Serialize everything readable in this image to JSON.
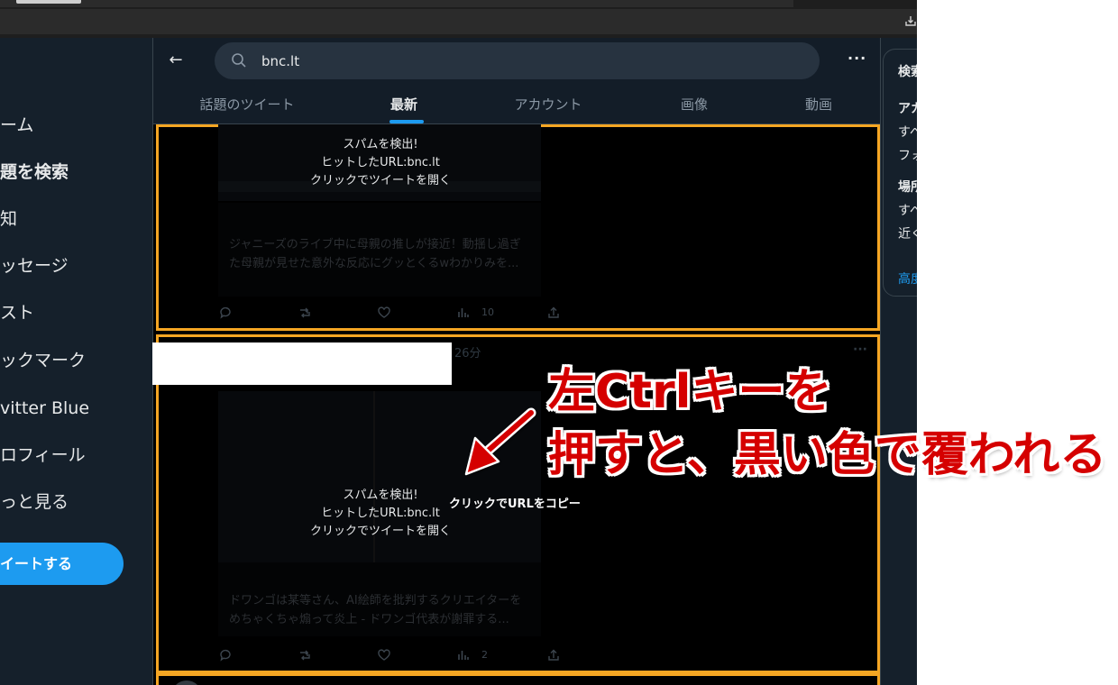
{
  "nav": {
    "items": [
      {
        "label": "ーム"
      },
      {
        "label": "題を検索"
      },
      {
        "label": "知"
      },
      {
        "label": "ッセージ"
      },
      {
        "label": "スト"
      },
      {
        "label": "ックマーク"
      },
      {
        "label": "vitter Blue"
      },
      {
        "label": "ロフィール"
      },
      {
        "label": "っと見る"
      }
    ],
    "tweet_button": "イートする"
  },
  "search": {
    "value": "bnc.lt"
  },
  "tabs": [
    {
      "label": "話題のツイート"
    },
    {
      "label": "最新"
    },
    {
      "label": "アカウント"
    },
    {
      "label": "画像"
    },
    {
      "label": "動画"
    }
  ],
  "spam_overlay": {
    "line1": "スパムを検出!",
    "line2": "ヒットしたURL:bnc.lt",
    "line3": "クリックでツイートを開く"
  },
  "tweets": [
    {
      "text_line1": "ジャニーズのライブ中に母親の推しが接近！動揺し過ぎ",
      "text_line2": "た母親が見せた意外な反応にグッとくるwわかりみを...",
      "views": "10"
    },
    {
      "time": "26分",
      "text_line1": "ドワンゴは某等さん、AI絵師を批判するクリエイターを",
      "text_line2": "めちゃくちゃ煽って炎上 - ドワンゴ代表が謝罪する...",
      "views": "2",
      "copy_label": "クリックでURLをコピー"
    }
  ],
  "right_panel": {
    "title": "検索",
    "lines": [
      "アカ",
      "すべ",
      "フォ",
      "場所",
      "すべ",
      "近く",
      "高度"
    ]
  },
  "annotation": {
    "line1": "左Ctrlキーを",
    "line2": "押すと、黒い色で覆われる",
    "color": "#d50000"
  }
}
